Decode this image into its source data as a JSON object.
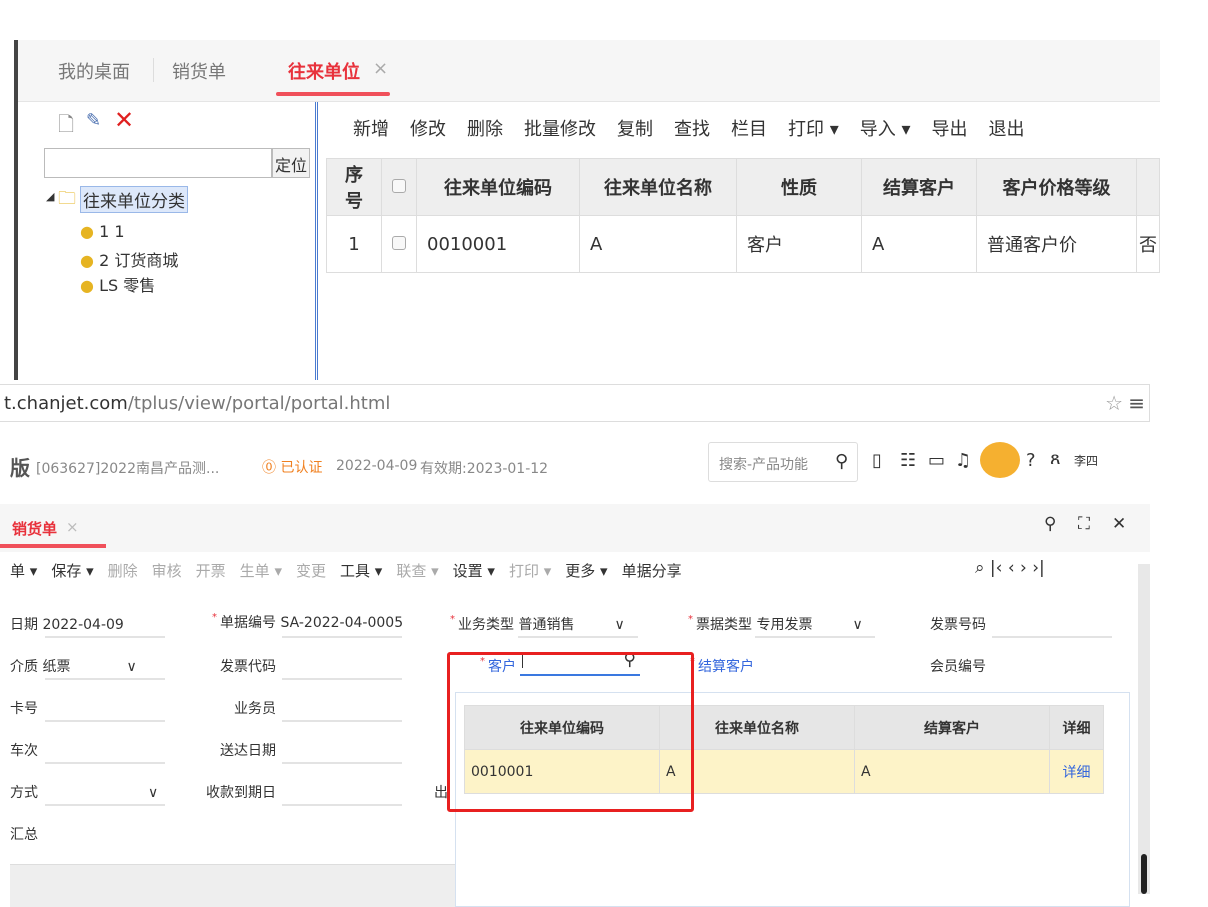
{
  "top_window": {
    "tabs": [
      {
        "label": "我的桌面"
      },
      {
        "label": "销货单"
      },
      {
        "label": "往来单位",
        "close": "×"
      }
    ],
    "tree": {
      "search_button": "定位",
      "root": "往来单位分类",
      "children": [
        "1 1",
        "2 订货商城",
        "LS 零售"
      ]
    },
    "toolbar": [
      "新增",
      "修改",
      "删除",
      "批量修改",
      "复制",
      "查找",
      "栏目",
      "打印 ▾",
      "导入 ▾",
      "导出",
      "退出"
    ],
    "table": {
      "headers": [
        "序号",
        "",
        "往来单位编码",
        "往来单位名称",
        "性质",
        "结算客户",
        "客户价格等级"
      ],
      "rows": [
        [
          "1",
          "",
          "0010001",
          "A",
          "客户",
          "A",
          "普通客户价"
        ]
      ],
      "cut_cell": "否"
    }
  },
  "bottom_window": {
    "url": {
      "domain": "t.chanjet.com",
      "path": "/tplus/view/portal/portal.html"
    },
    "header": {
      "edition": "版",
      "account": "[063627]2022南昌产品测...",
      "certified": "已认证",
      "date": "2022-04-09",
      "validity": "有效期:2023-01-12",
      "search_placeholder": "搜索-产品功能",
      "user": "李四"
    },
    "tab": {
      "label": "销货单",
      "close": "×"
    },
    "toolbar": [
      "单 ▾",
      "保存 ▾",
      "删除",
      "审核",
      "开票",
      "生单 ▾",
      "变更",
      "工具 ▾",
      "联查 ▾",
      "设置 ▾",
      "打印 ▾",
      "更多 ▾",
      "单据分享"
    ],
    "form": {
      "date_label": "日期",
      "date_value": "2022-04-09",
      "doc_no_label": "单据编号",
      "doc_no_value": "SA-2022-04-0005",
      "biz_type_label": "业务类型",
      "biz_type_value": "普通销售",
      "invoice_type_label": "票据类型",
      "invoice_type_value": "专用发票",
      "invoice_no_label": "发票号码",
      "medium_label": "介质",
      "medium_value": "纸票",
      "invoice_code_label": "发票代码",
      "customer_label": "客户",
      "customer_value": "",
      "settle_customer_label": "结算客户",
      "member_no_label": "会员编号",
      "card_label": "卡号",
      "salesman_label": "业务员",
      "trip_label": "车次",
      "delivery_date_label": "送达日期",
      "method_label": "方式",
      "due_date_label": "收款到期日",
      "cut_label": "出",
      "summary_label": "汇总"
    },
    "dropdown": {
      "headers": [
        "往来单位编码",
        "往来单位名称",
        "结算客户",
        "详细"
      ],
      "rows": [
        [
          "0010001",
          "A",
          "A",
          "详细"
        ]
      ]
    }
  },
  "colors": {
    "accent": "#e8323c",
    "highlight_row": "#fdf3c8",
    "annotation": "#e82020",
    "link": "#3366dd"
  }
}
